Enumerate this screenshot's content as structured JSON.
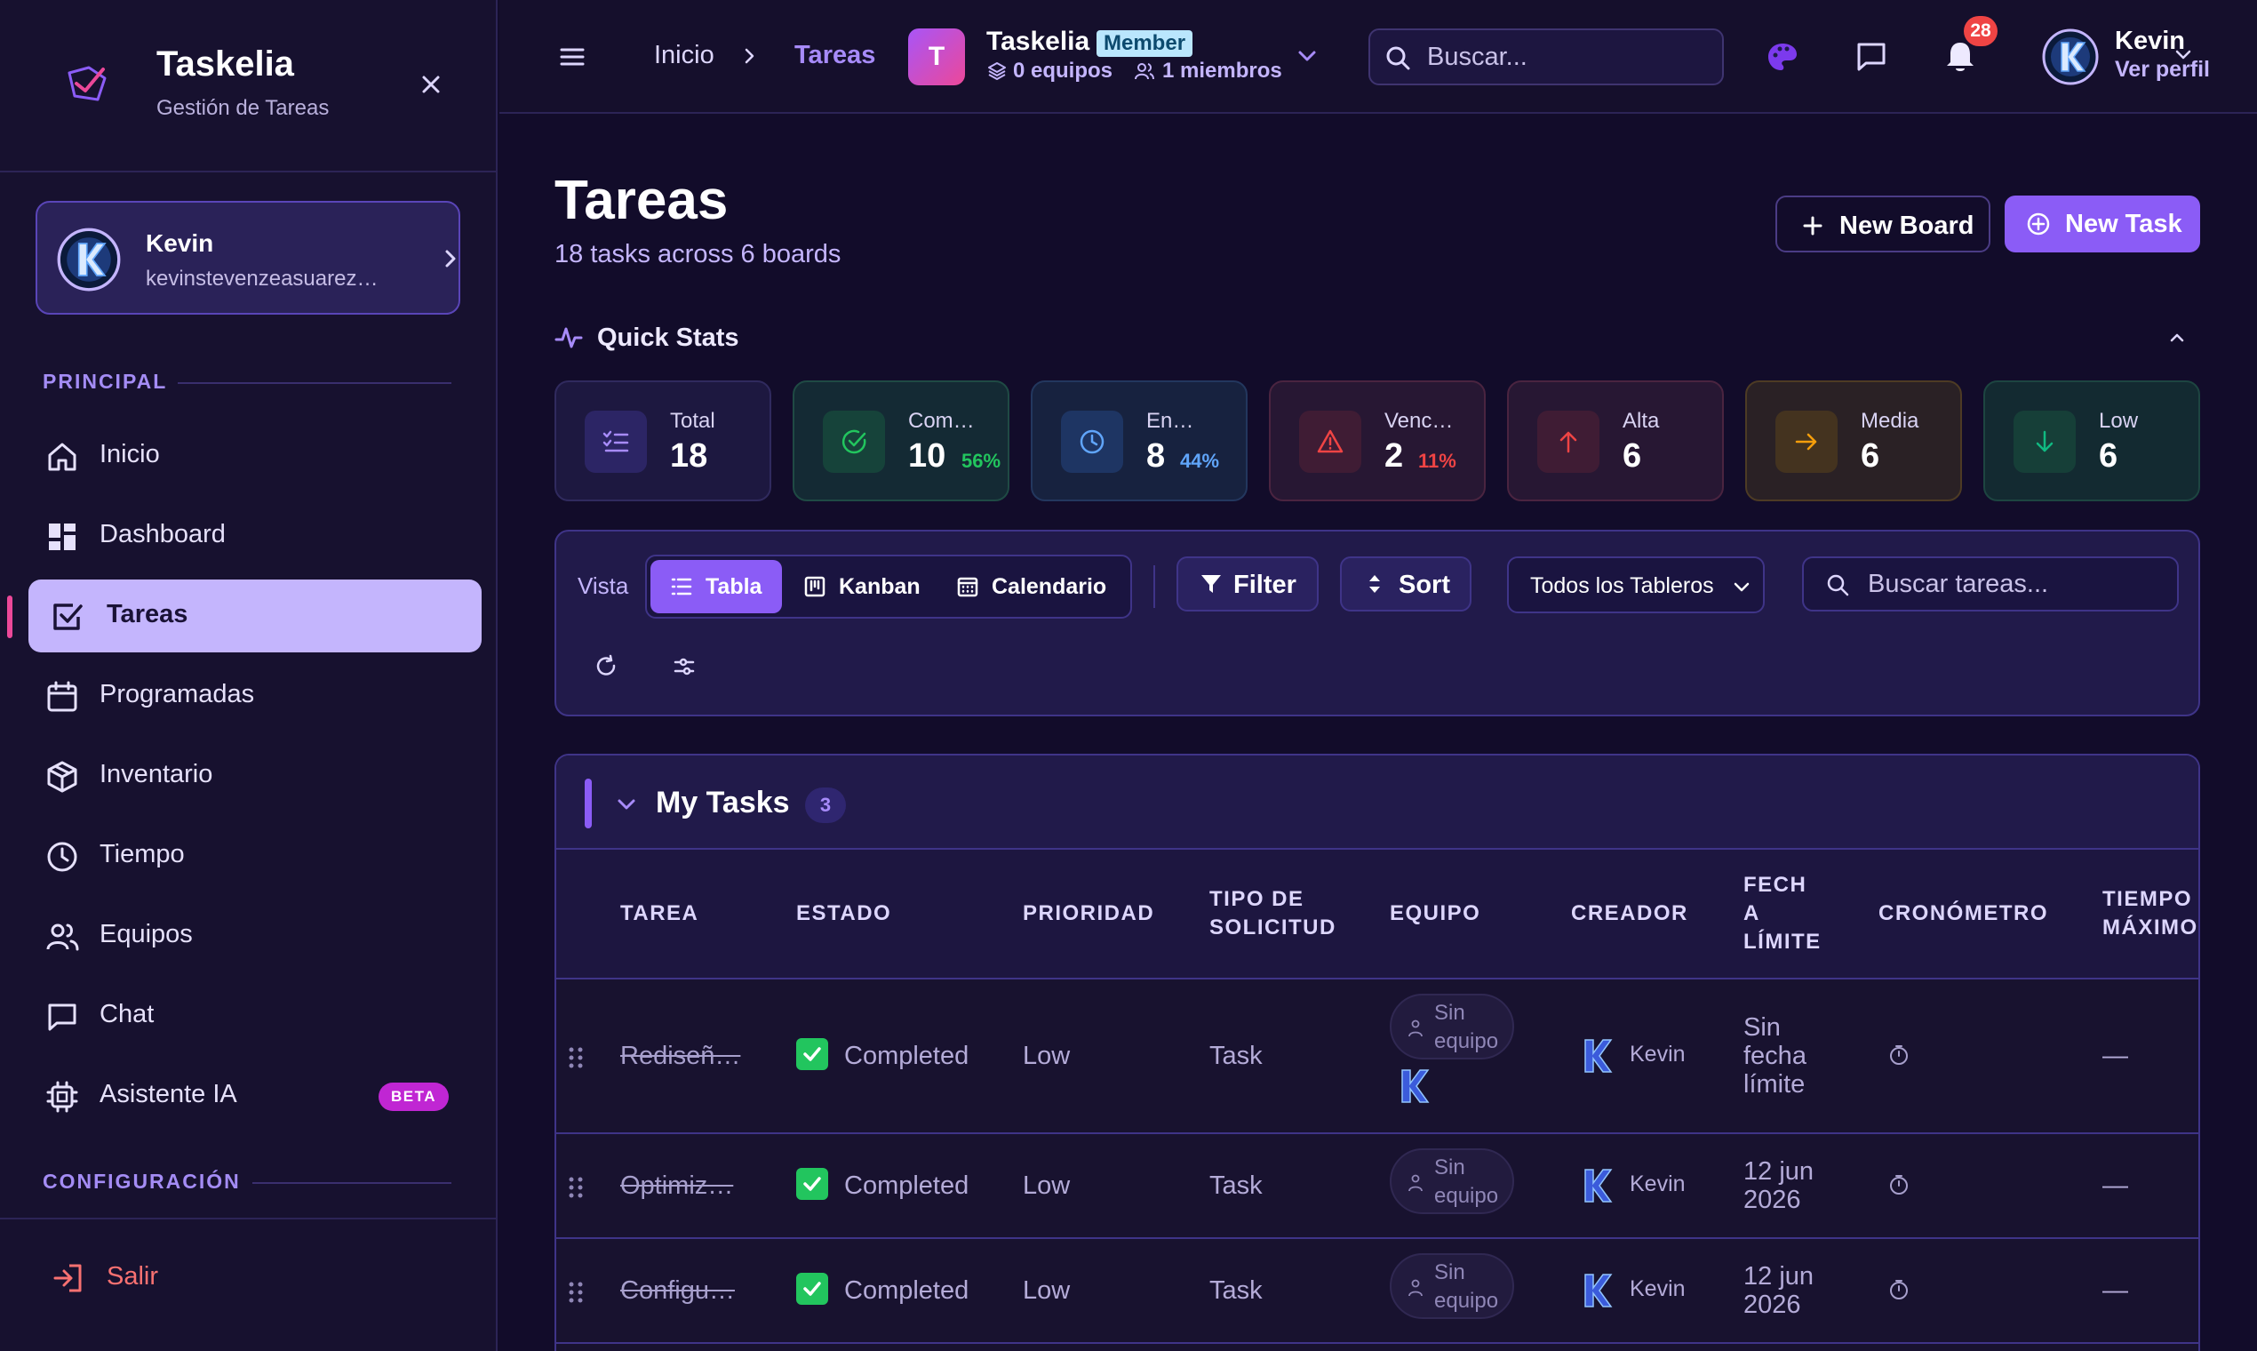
{
  "app": {
    "name": "Taskelia",
    "subtitle": "Gestión de Tareas",
    "accent": "#8b5cf6",
    "background": "#120c2a"
  },
  "sidebar": {
    "user": {
      "name": "Kevin",
      "email": "kevinstevenzeasuarez…"
    },
    "sections": {
      "principal": "PRINCIPAL",
      "config": "CONFIGURACIÓN"
    },
    "items": [
      {
        "label": "Inicio",
        "icon": "home-icon"
      },
      {
        "label": "Dashboard",
        "icon": "dashboard-icon"
      },
      {
        "label": "Tareas",
        "icon": "tasks-icon",
        "active": true
      },
      {
        "label": "Programadas",
        "icon": "calendar-icon"
      },
      {
        "label": "Inventario",
        "icon": "box-icon"
      },
      {
        "label": "Tiempo",
        "icon": "clock-icon"
      },
      {
        "label": "Equipos",
        "icon": "users-icon"
      },
      {
        "label": "Chat",
        "icon": "chat-icon"
      },
      {
        "label": "Asistente IA",
        "icon": "cpu-icon",
        "badge": "BETA"
      }
    ],
    "logout": "Salir"
  },
  "topbar": {
    "breadcrumb": {
      "home": "Inicio",
      "current": "Tareas"
    },
    "workspace": {
      "initial": "T",
      "name": "Taskelia",
      "role": "Member",
      "teams": "0 equipos",
      "members": "1 miembros"
    },
    "search_placeholder": "Buscar...",
    "notifications": "28",
    "user": {
      "name": "Kevin",
      "profile_link": "Ver perfil"
    }
  },
  "page": {
    "title": "Tareas",
    "subtitle": "18 tasks across 6 boards",
    "new_board": "New Board",
    "new_task": "New Task"
  },
  "quick_stats": {
    "title": "Quick Stats",
    "items": [
      {
        "label": "Total",
        "value": "18",
        "pct": "",
        "color": "#a78bfa"
      },
      {
        "label": "Com…",
        "value": "10",
        "pct": "56%",
        "color": "#22c55e"
      },
      {
        "label": "En…",
        "value": "8",
        "pct": "44%",
        "color": "#60a5fa"
      },
      {
        "label": "Venc…",
        "value": "2",
        "pct": "11%",
        "color": "#ef4444"
      },
      {
        "label": "Alta",
        "value": "6",
        "pct": "",
        "color": "#ef4444"
      },
      {
        "label": "Media",
        "value": "6",
        "pct": "",
        "color": "#f59e0b"
      },
      {
        "label": "Low",
        "value": "6",
        "pct": "",
        "color": "#10b981"
      }
    ]
  },
  "view": {
    "label": "Vista",
    "modes": [
      "Tabla",
      "Kanban",
      "Calendario"
    ],
    "active_mode": "Tabla",
    "filter": "Filter",
    "sort": "Sort",
    "board_select": "Todos los Tableros",
    "task_search_placeholder": "Buscar tareas..."
  },
  "group": {
    "title": "My Tasks",
    "count": "3",
    "columns": [
      "TAREA",
      "ESTADO",
      "PRIORIDAD",
      "TIPO DE\nSOLICITUD",
      "EQUIPO",
      "CREADOR",
      "FECH\nA\nLÍMITE",
      "CRONÓMETRO",
      "TIEMPO\nMÁXIMO"
    ],
    "rows": [
      {
        "task": "Rediseñ…",
        "status": "Completed",
        "priority": "Low",
        "type": "Task",
        "team": "Sin equipo",
        "creator": "Kevin",
        "due": "Sin fecha límite",
        "max_time": "—"
      },
      {
        "task": "Optimiz…",
        "status": "Completed",
        "priority": "Low",
        "type": "Task",
        "team": "Sin equipo",
        "creator": "Kevin",
        "due": "12 jun 2026",
        "max_time": "—"
      },
      {
        "task": "Configu…",
        "status": "Completed",
        "priority": "Low",
        "type": "Task",
        "team": "Sin equipo",
        "creator": "Kevin",
        "due": "12 jun 2026",
        "max_time": "—"
      }
    ]
  }
}
